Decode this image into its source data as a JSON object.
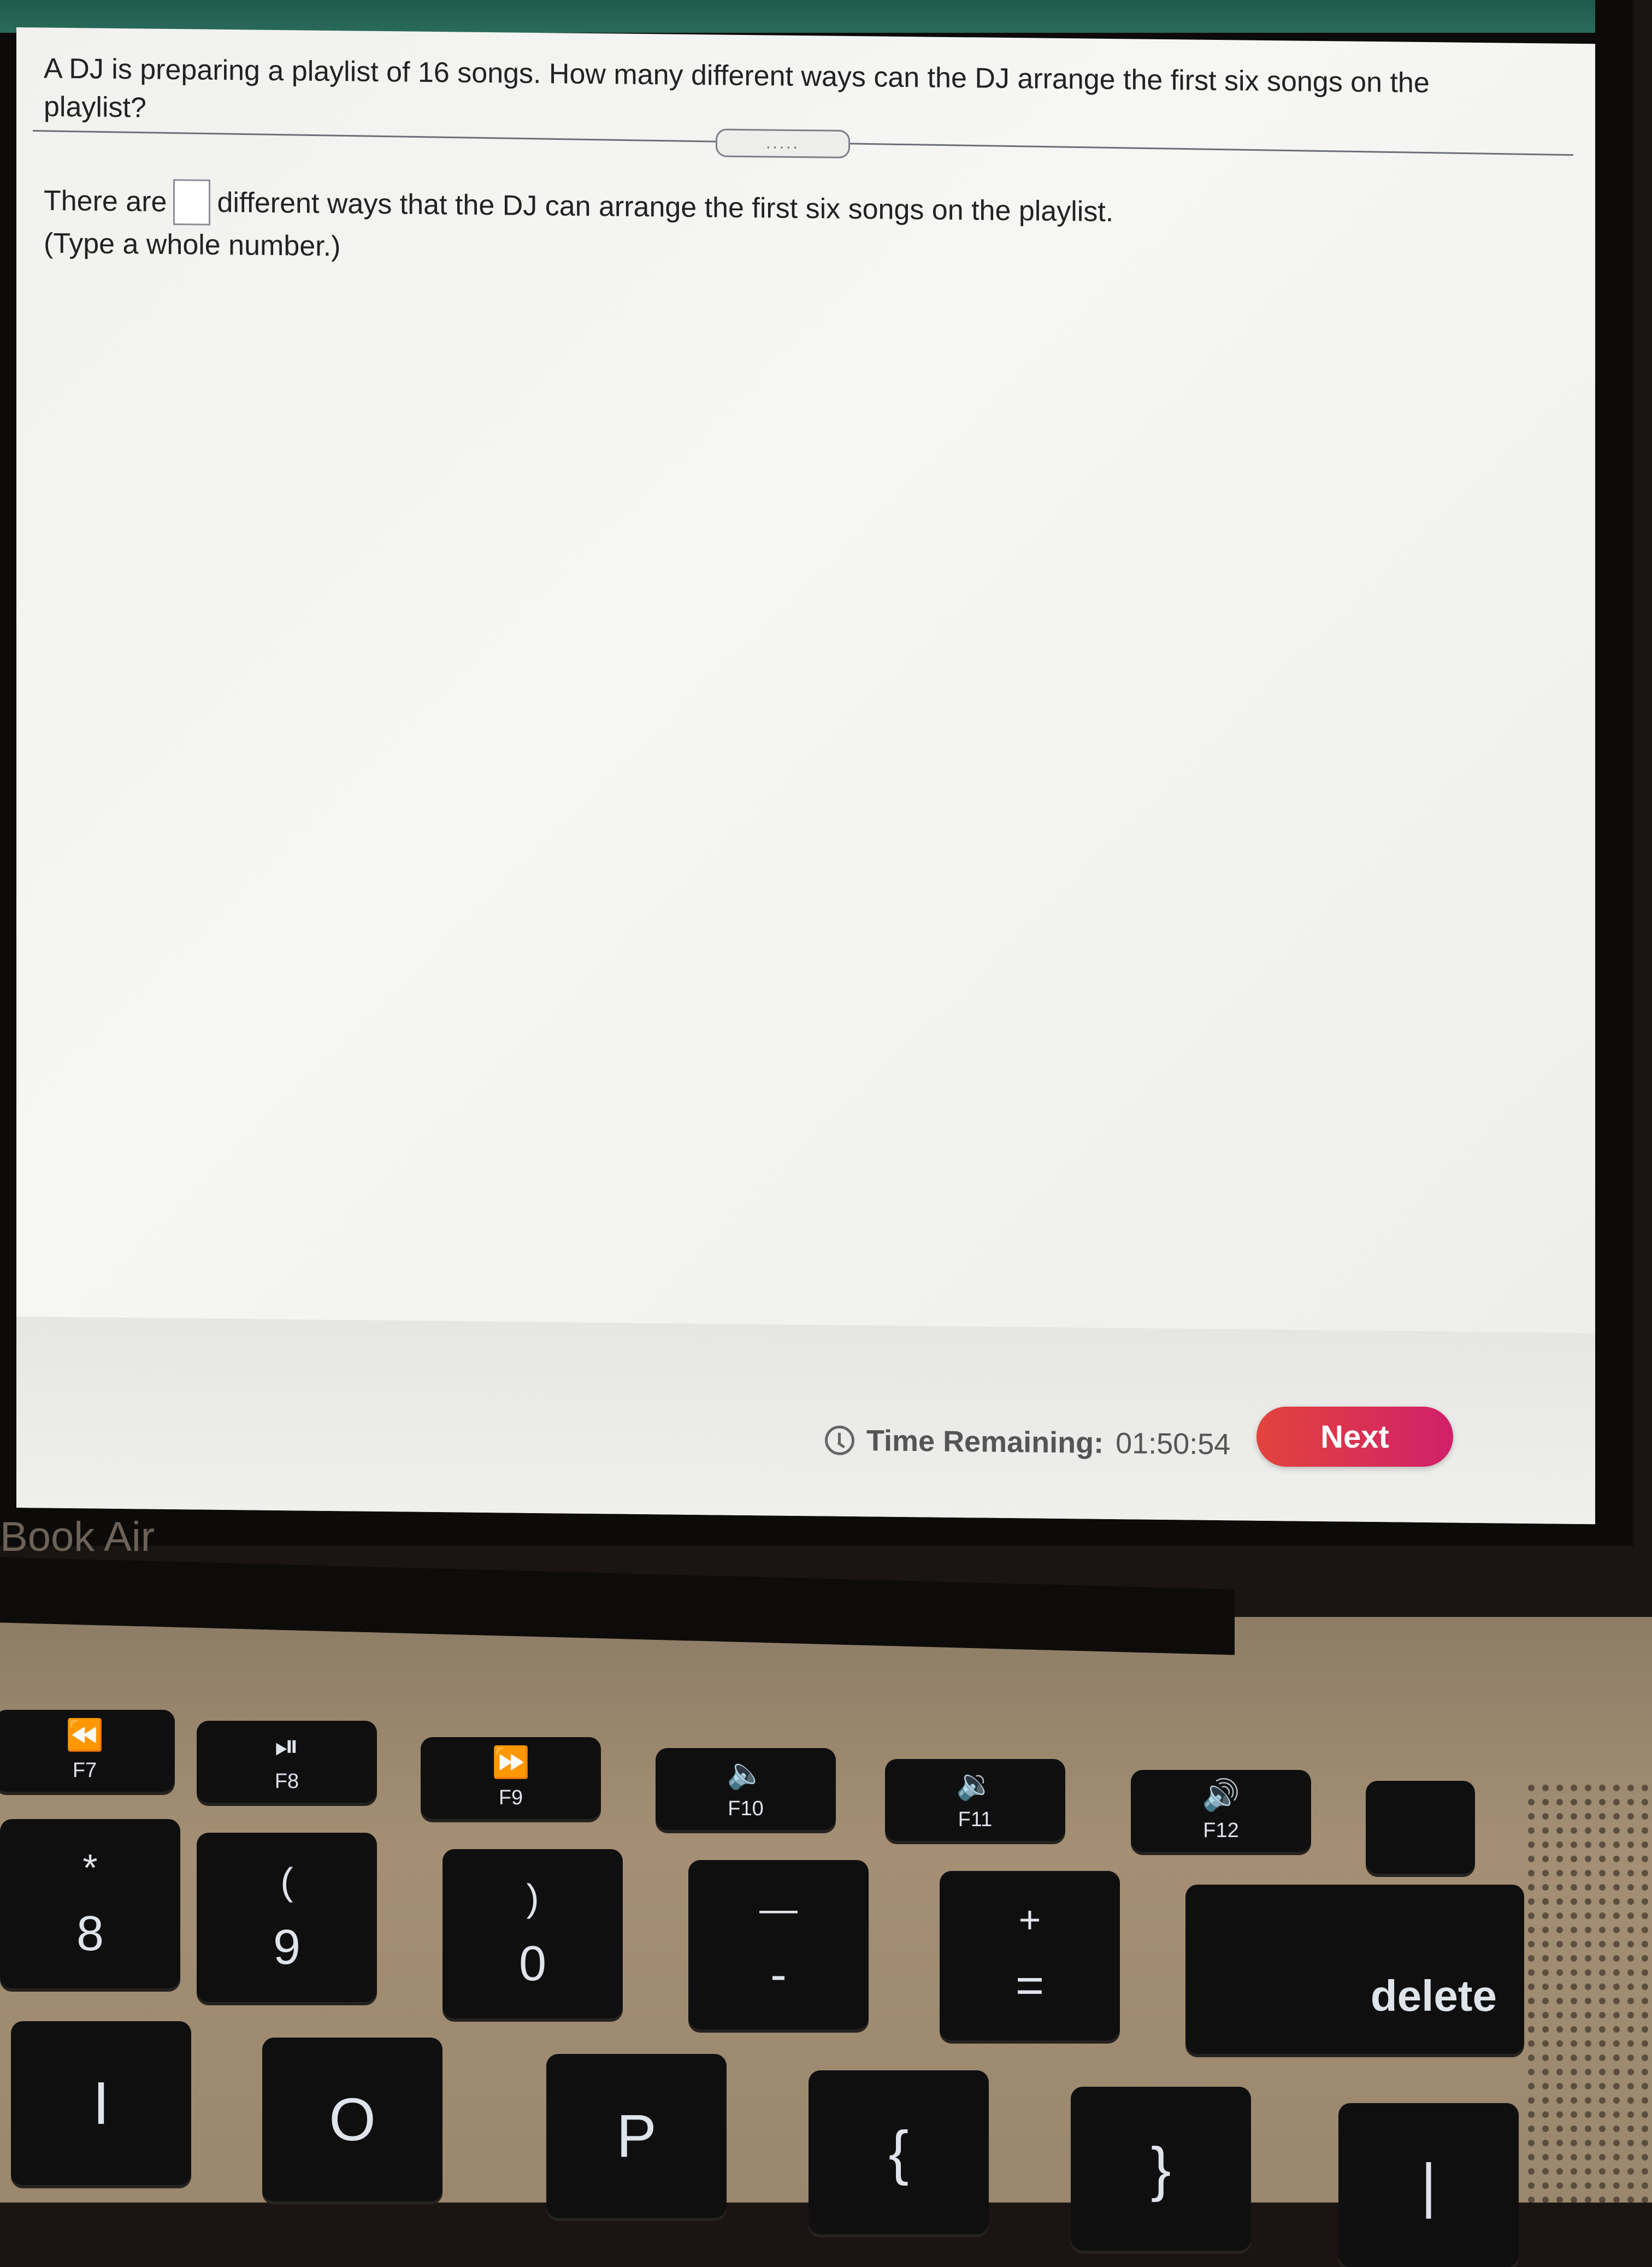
{
  "top_banner_color": "#2a6b5a",
  "question": {
    "text": "A DJ is preparing a playlist of 16 songs. How many different ways can the DJ arrange the first six songs on the playlist?"
  },
  "divider": {
    "handle_label": "....."
  },
  "answer": {
    "prefix": "There are",
    "value": "",
    "suffix": "different ways that the DJ can arrange the first six songs on the playlist.",
    "hint": "(Type a whole number.)"
  },
  "footer": {
    "timer_icon": "clock-icon",
    "timer_label": "Time Remaining:",
    "timer_value": "01:50:54",
    "next_label": "Next",
    "next_color": "#d92d55"
  },
  "device": {
    "brand_label": "Book Air"
  },
  "keyboard": {
    "function_keys": [
      {
        "glyph": "⏪",
        "icon": "rewind-icon",
        "label": "F7"
      },
      {
        "glyph": "⏯",
        "icon": "play-pause-icon",
        "label": "F8"
      },
      {
        "glyph": "⏩",
        "icon": "fast-forward-icon",
        "label": "F9"
      },
      {
        "glyph": "🔈",
        "icon": "mute-icon",
        "label": "F10"
      },
      {
        "glyph": "🔉",
        "icon": "volume-down-icon",
        "label": "F11"
      },
      {
        "glyph": "🔊",
        "icon": "volume-up-icon",
        "label": "F12"
      }
    ],
    "number_keys": [
      {
        "shift": "*",
        "main": "8"
      },
      {
        "shift": "(",
        "main": "9"
      },
      {
        "shift": ")",
        "main": "0"
      },
      {
        "shift": "—",
        "main": "-"
      },
      {
        "shift": "+",
        "main": "="
      }
    ],
    "delete_label": "delete",
    "letter_keys": [
      "I",
      "O",
      "P",
      "{",
      "}",
      "|"
    ]
  }
}
